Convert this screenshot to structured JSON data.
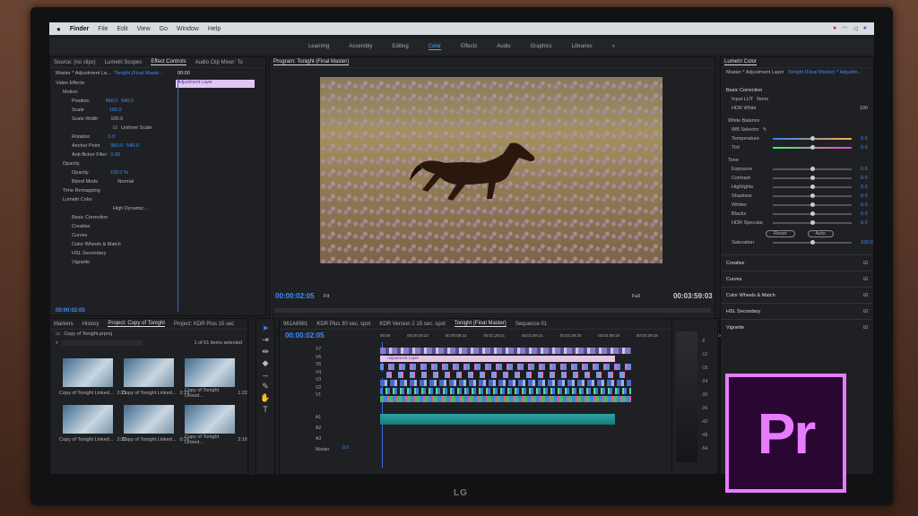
{
  "menubar": {
    "app": "Finder",
    "items": [
      "File",
      "Edit",
      "View",
      "Go",
      "Window",
      "Help"
    ]
  },
  "workspaces": {
    "items": [
      "Learning",
      "Assembly",
      "Editing",
      "Color",
      "Effects",
      "Audio",
      "Graphics",
      "Libraries"
    ],
    "active": "Color",
    "more": "»"
  },
  "left_panel": {
    "tabs": [
      "Source: (no clips)",
      "Lumetri Scopes",
      "Effect Controls",
      "Audio Clip Mixer: To"
    ],
    "master": "Master * Adjustment La...",
    "sequence": "Tonight (Final Maste...",
    "clip_time": "00:00",
    "clip_label": "Adjustment Layer",
    "section": "Video Effects",
    "rows": [
      {
        "label": "Motion"
      },
      {
        "label": "Position",
        "v1": "960.0",
        "v2": "540.0"
      },
      {
        "label": "Scale",
        "v1": "100.0"
      },
      {
        "label": "Scale Width",
        "v1": "100.0"
      },
      {
        "label": "Uniform Scale"
      },
      {
        "label": "Rotation",
        "v1": "0.0"
      },
      {
        "label": "Anchor Point",
        "v1": "960.0",
        "v2": "540.0"
      },
      {
        "label": "Anti-flicker Filter",
        "v1": "0.00"
      },
      {
        "label": "Opacity"
      },
      {
        "label": "Opacity",
        "v1": "100.0 %"
      },
      {
        "label": "Blend Mode",
        "v1": "Normal"
      },
      {
        "label": "Time Remapping"
      },
      {
        "label": "Lumetri Color"
      },
      {
        "label": "High Dynamic..."
      },
      {
        "label": "Basic Correction"
      },
      {
        "label": "Creative"
      },
      {
        "label": "Curves"
      },
      {
        "label": "Color Wheels & Match"
      },
      {
        "label": "HSL Secondary"
      },
      {
        "label": "Vignette"
      }
    ],
    "bottom_time": "00:00:02:05"
  },
  "program": {
    "title": "Program: Tonight (Final Master)",
    "timecode": "00:00:02:05",
    "fit": "Fit",
    "full": "Full",
    "duration": "00:03:59:03"
  },
  "lumetri": {
    "title": "Lumetri Color",
    "master": "Master * Adjustment Layer",
    "sequence": "Tonight (Final Master) * Adjustm...",
    "basic": "Basic Correction",
    "input_lut": "Input LUT",
    "lut_val": "None",
    "hdr_white": "HDR White",
    "hdr_val": "100",
    "white_balance": "White Balance",
    "wb_selector": "WB Selector",
    "temperature": "Temperature",
    "temp_val": "0.0",
    "tint": "Tint",
    "tint_val": "0.0",
    "tone": "Tone",
    "tone_rows": [
      {
        "label": "Exposure",
        "v": "0.0"
      },
      {
        "label": "Contrast",
        "v": "0.0"
      },
      {
        "label": "Highlights",
        "v": "0.0"
      },
      {
        "label": "Shadows",
        "v": "0.0"
      },
      {
        "label": "Whites",
        "v": "0.0"
      },
      {
        "label": "Blacks",
        "v": "0.0"
      },
      {
        "label": "HDR Specular",
        "v": "0.0"
      }
    ],
    "reset": "Reset",
    "auto": "Auto",
    "saturation": "Saturation",
    "sat_val": "100.0",
    "sections": [
      "Creative",
      "Curves",
      "Color Wheels & Match",
      "HSL Secondary",
      "Vignette"
    ]
  },
  "project": {
    "tabs": [
      "Markers",
      "History",
      "Project: Copy of Tonight",
      "Project: KDR Plus 15 sec"
    ],
    "file": "Copy of Tonight.prproj",
    "count": "1 of 61 items selected",
    "thumbs": [
      {
        "label": "Copy of Tonight Linked...",
        "dur": "2:21"
      },
      {
        "label": "Copy of Tonight Linked...",
        "dur": "2:19"
      },
      {
        "label": "Copy of Tonight Linked...",
        "dur": "1:22"
      },
      {
        "label": "Copy of Tonight Linked...",
        "dur": "2:20"
      },
      {
        "label": "Copy of Tonight Linked...",
        "dur": "0:16"
      },
      {
        "label": "Copy of Tonight Linked...",
        "dur": "2:16"
      }
    ]
  },
  "timeline": {
    "tabs": [
      "961A6981",
      "KDR Plus 30 sec. spot",
      "KDR Version 2 15 sec. spot",
      "Tonight (Final Master)",
      "Sequence 01"
    ],
    "timecode": "00:00:02:05",
    "ruler": [
      "00:00",
      "00:00:29:23",
      "00:00:59:22",
      "00:01:29:21",
      "00:01:59:21",
      "00:02:29:20",
      "00:02:59:19",
      "00:03:29:18",
      "00:03:59:18",
      "00:0"
    ],
    "video_tracks": [
      "V7",
      "V6",
      "V5",
      "V4",
      "V3",
      "V2",
      "V1"
    ],
    "audio_tracks": [
      "A1",
      "A2",
      "A3"
    ],
    "master": "Master",
    "master_val": "0.0",
    "adj_label": "Adjustment Layer"
  },
  "meter": {
    "ticks": [
      "-6",
      "-12",
      "-18",
      "-24",
      "-30",
      "-36",
      "-42",
      "-48",
      "-54"
    ]
  },
  "brand": {
    "monitor": "LG",
    "logo": "Pr"
  }
}
